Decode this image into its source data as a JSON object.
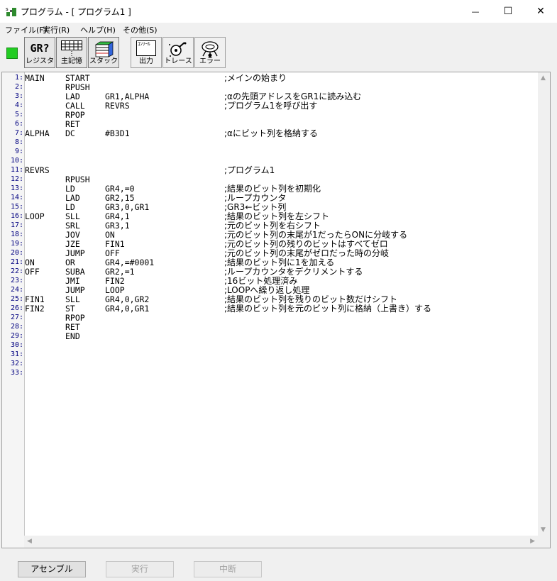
{
  "window": {
    "title": "プログラム - [ プログラム1 ]",
    "minimize_glyph": "—",
    "maximize_glyph": "☐",
    "close_glyph": "✕"
  },
  "menu": [
    {
      "label": "ファイル(F)"
    },
    {
      "label": "実行(R)"
    },
    {
      "label": "ヘルプ(H)"
    },
    {
      "label": "その他(S)"
    }
  ],
  "toolbar": {
    "status_color": "#22cc22",
    "buttons": [
      {
        "label": "レジスタ",
        "icon": "register-icon",
        "icon_text": "GR?",
        "pressed": true
      },
      {
        "label": "主記憶",
        "icon": "memory-grid-icon",
        "pressed": true
      },
      {
        "label": "スタック",
        "icon": "stack-icon",
        "pressed": true
      },
      {
        "label": "出力",
        "icon": "console-output-icon",
        "icon_text": "ｺﾝｿｰﾙ",
        "pressed": false
      },
      {
        "label": "トレース",
        "icon": "trace-magnifier-icon",
        "pressed": false
      },
      {
        "label": "エラー",
        "icon": "error-bug-icon",
        "pressed": false
      }
    ]
  },
  "editor": {
    "line_count": 33,
    "lines": [
      {
        "label": "MAIN",
        "op": "START",
        "arg": "",
        "comment": ";メインの始まり"
      },
      {
        "label": "",
        "op": "RPUSH",
        "arg": "",
        "comment": ""
      },
      {
        "label": "",
        "op": "LAD",
        "arg": "GR1,ALPHA",
        "comment": ";αの先頭アドレスをGR1に読み込む"
      },
      {
        "label": "",
        "op": "CALL",
        "arg": "REVRS",
        "comment": ";プログラム1を呼び出す"
      },
      {
        "label": "",
        "op": "RPOP",
        "arg": "",
        "comment": ""
      },
      {
        "label": "",
        "op": "RET",
        "arg": "",
        "comment": ""
      },
      {
        "label": "ALPHA",
        "op": "DC",
        "arg": "#B3D1",
        "comment": ";αにビット列を格納する"
      },
      {
        "label": "",
        "op": "",
        "arg": "",
        "comment": ""
      },
      {
        "label": "",
        "op": "",
        "arg": "",
        "comment": ""
      },
      {
        "label": "",
        "op": "",
        "arg": "",
        "comment": ""
      },
      {
        "label": "REVRS",
        "op": "",
        "arg": "",
        "comment": ";プログラム1"
      },
      {
        "label": "",
        "op": "RPUSH",
        "arg": "",
        "comment": ""
      },
      {
        "label": "",
        "op": "LD",
        "arg": "GR4,=0",
        "comment": ";結果のビット列を初期化"
      },
      {
        "label": "",
        "op": "LAD",
        "arg": "GR2,15",
        "comment": ";ループカウンタ"
      },
      {
        "label": "",
        "op": "LD",
        "arg": "GR3,0,GR1",
        "comment": ";GR3←ビット列"
      },
      {
        "label": "LOOP",
        "op": "SLL",
        "arg": "GR4,1",
        "comment": ";結果のビット列を左シフト"
      },
      {
        "label": "",
        "op": "SRL",
        "arg": "GR3,1",
        "comment": ";元のビット列を右シフト"
      },
      {
        "label": "",
        "op": "JOV",
        "arg": "ON",
        "comment": ";元のビット列の末尾が1だったらONに分岐する"
      },
      {
        "label": "",
        "op": "JZE",
        "arg": "FIN1",
        "comment": ";元のビット列の残りのビットはすべてゼロ"
      },
      {
        "label": "",
        "op": "JUMP",
        "arg": "OFF",
        "comment": ";元のビット列の末尾がゼロだった時の分岐"
      },
      {
        "label": "ON",
        "op": "OR",
        "arg": "GR4,=#0001",
        "comment": ";結果のビット列に1を加える"
      },
      {
        "label": "OFF",
        "op": "SUBA",
        "arg": "GR2,=1",
        "comment": ";ループカウンタをデクリメントする"
      },
      {
        "label": "",
        "op": "JMI",
        "arg": "FIN2",
        "comment": ";16ビット処理済み"
      },
      {
        "label": "",
        "op": "JUMP",
        "arg": "LOOP",
        "comment": ";LOOPへ繰り返し処理"
      },
      {
        "label": "FIN1",
        "op": "SLL",
        "arg": "GR4,0,GR2",
        "comment": ";結果のビット列を残りのビット数だけシフト"
      },
      {
        "label": "FIN2",
        "op": "ST",
        "arg": "GR4,0,GR1",
        "comment": ";結果のビット列を元のビット列に格納（上書き）する"
      },
      {
        "label": "",
        "op": "RPOP",
        "arg": "",
        "comment": ""
      },
      {
        "label": "",
        "op": "RET",
        "arg": "",
        "comment": ""
      },
      {
        "label": "",
        "op": "END",
        "arg": "",
        "comment": ""
      }
    ]
  },
  "actions": {
    "assemble": "アセンブル",
    "run": "実行",
    "abort": "中断"
  }
}
